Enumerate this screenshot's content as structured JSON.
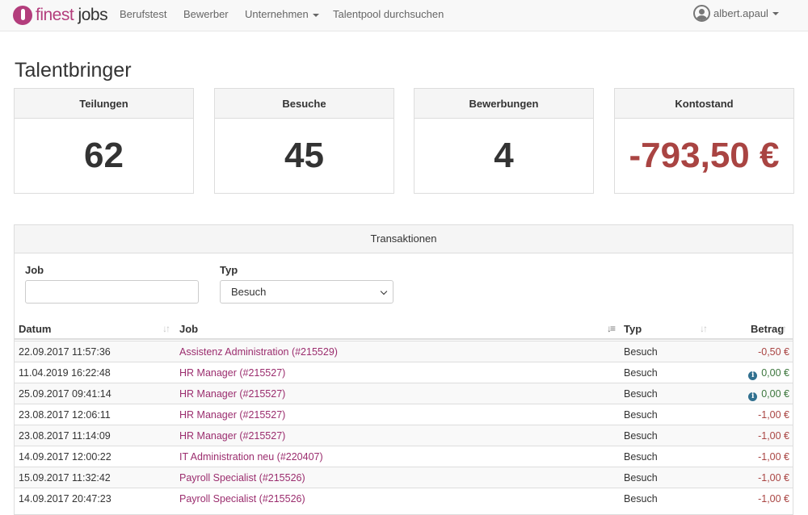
{
  "brand": {
    "name_part1": "finest",
    "name_part2": "jobs"
  },
  "nav": {
    "items": [
      {
        "label": "Berufstest"
      },
      {
        "label": "Bewerber"
      },
      {
        "label": "Unternehmen"
      },
      {
        "label": "Talentpool durchsuchen"
      }
    ],
    "user": "albert.apaul"
  },
  "page": {
    "title": "Talentbringer"
  },
  "stats": [
    {
      "label": "Teilungen",
      "value": "62"
    },
    {
      "label": "Besuche",
      "value": "45"
    },
    {
      "label": "Bewerbungen",
      "value": "4"
    },
    {
      "label": "Kontostand",
      "value": "-793,50 €"
    }
  ],
  "transactions": {
    "title": "Transaktionen",
    "filters": {
      "job_label": "Job",
      "job_value": "",
      "typ_label": "Typ",
      "typ_selected": "Besuch"
    },
    "columns": [
      "Datum",
      "Job",
      "Typ",
      "Betrag"
    ],
    "rows": [
      {
        "datum": "22.09.2017 11:57:36",
        "job": "Assistenz Administration (#215529)",
        "typ": "Besuch",
        "betrag": "-0,50 €"
      },
      {
        "datum": "11.04.2019 16:22:48",
        "job": "HR Manager (#215527)",
        "typ": "Besuch",
        "betrag": "0,00 €"
      },
      {
        "datum": "25.09.2017 09:41:14",
        "job": "HR Manager (#215527)",
        "typ": "Besuch",
        "betrag": "0,00 €"
      },
      {
        "datum": "23.08.2017 12:06:11",
        "job": "HR Manager (#215527)",
        "typ": "Besuch",
        "betrag": "-1,00 €"
      },
      {
        "datum": "23.08.2017 11:14:09",
        "job": "HR Manager (#215527)",
        "typ": "Besuch",
        "betrag": "-1,00 €"
      },
      {
        "datum": "14.09.2017 12:00:22",
        "job": "IT Administration neu (#220407)",
        "typ": "Besuch",
        "betrag": "-1,00 €"
      },
      {
        "datum": "15.09.2017 11:32:42",
        "job": "Payroll Specialist (#215526)",
        "typ": "Besuch",
        "betrag": "-1,00 €"
      },
      {
        "datum": "14.09.2017 20:47:23",
        "job": "Payroll Specialist (#215526)",
        "typ": "Besuch",
        "betrag": "-1,00 €"
      }
    ]
  },
  "colors": {
    "brand": "#b33d7c",
    "negative": "#a94442",
    "positive": "#3c763d",
    "info": "#31708f"
  }
}
